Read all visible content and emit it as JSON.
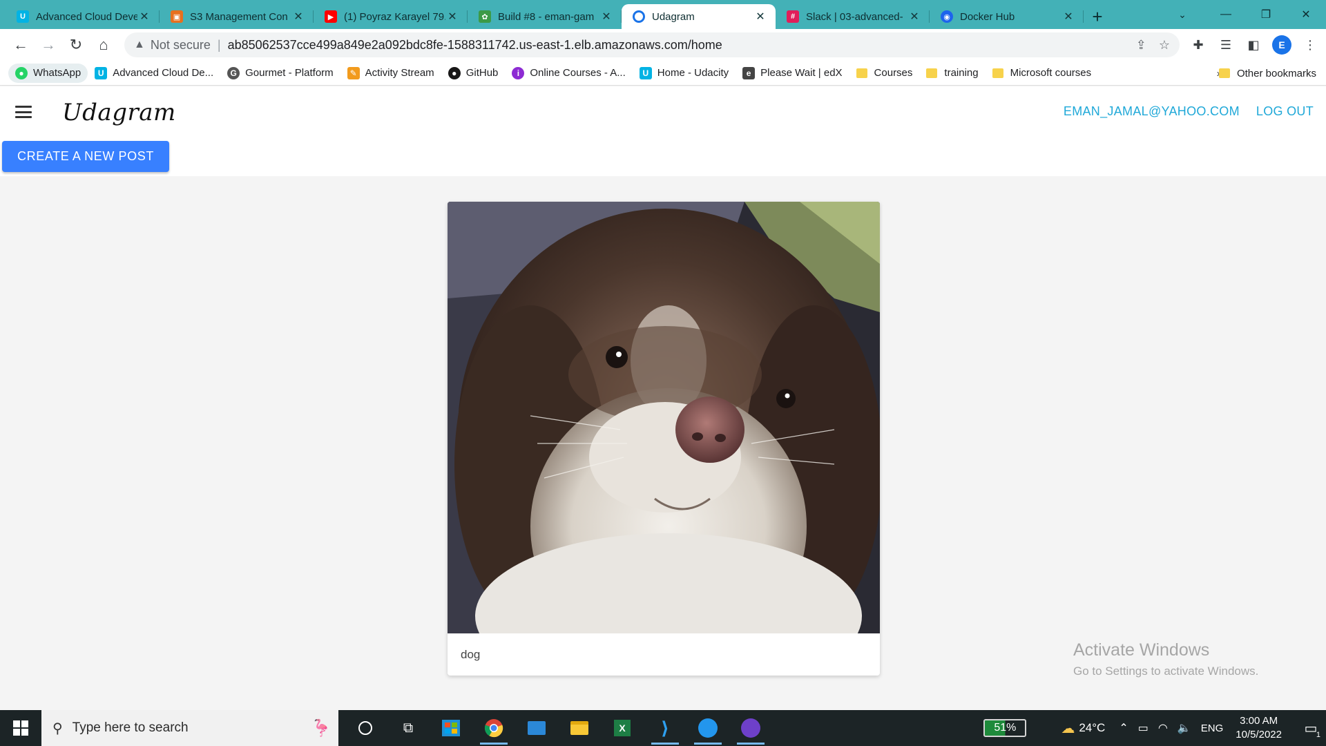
{
  "browser": {
    "tabs": [
      {
        "title": "Advanced Cloud Deve",
        "favicon": "udacity-icon",
        "color": "#02b3e4"
      },
      {
        "title": "S3 Management Con",
        "favicon": "aws-s3-icon",
        "color": "#e7701f"
      },
      {
        "title": "(1) Poyraz Karayel 79.",
        "favicon": "youtube-icon",
        "color": "#ff0000"
      },
      {
        "title": "Build #8 - eman-gam",
        "favicon": "circleci-icon",
        "color": "#3c9a47"
      },
      {
        "title": "Udagram",
        "favicon": "globe-icon",
        "color": "#1a73e8"
      },
      {
        "title": "Slack | 03-advanced-",
        "favicon": "slack-icon",
        "color": "#e01e5a"
      },
      {
        "title": "Docker Hub",
        "favicon": "docker-icon",
        "color": "#1d63ed"
      }
    ],
    "active_tab_index": 4,
    "address": {
      "security_label": "Not secure",
      "url": "ab85062537cce499a849e2a092bdc8fe-1588311742.us-east-1.elb.amazonaws.com/home"
    },
    "profile_initial": "E",
    "bookmarks": [
      {
        "label": "WhatsApp",
        "icon": "whatsapp-icon",
        "color": "#25d366"
      },
      {
        "label": "Advanced Cloud De...",
        "icon": "udacity-icon",
        "color": "#02b3e4"
      },
      {
        "label": "Gourmet - Platform",
        "icon": "gourmet-icon",
        "color": "#555555"
      },
      {
        "label": "Activity Stream",
        "icon": "activity-icon",
        "color": "#f29b1d"
      },
      {
        "label": "GitHub",
        "icon": "github-icon",
        "color": "#181717"
      },
      {
        "label": "Online Courses - A...",
        "icon": "online-courses-icon",
        "color": "#8d2bd3"
      },
      {
        "label": "Home - Udacity",
        "icon": "udacity-icon",
        "color": "#02b3e4"
      },
      {
        "label": "Please Wait | edX",
        "icon": "edx-icon",
        "color": "#444444"
      },
      {
        "label": "Courses",
        "icon": "folder-icon",
        "color": "#f7d24b"
      },
      {
        "label": "training",
        "icon": "folder-icon",
        "color": "#f7d24b"
      },
      {
        "label": "Microsoft courses",
        "icon": "folder-icon",
        "color": "#f7d24b"
      }
    ],
    "bookmarks_more": "»",
    "other_bookmarks": "Other bookmarks"
  },
  "app": {
    "brand": "Udagram",
    "user_email": "EMAN_JAMAL@YAHOO.COM",
    "logout_label": "LOG OUT",
    "create_post_label": "CREATE A NEW POST",
    "accent_color": "#3880ff",
    "link_color": "#1fa8d8",
    "posts": [
      {
        "caption": "dog",
        "image": "dog-photo"
      }
    ]
  },
  "watermark": {
    "title": "Activate Windows",
    "subtitle": "Go to Settings to activate Windows."
  },
  "taskbar": {
    "search_placeholder": "Type here to search",
    "battery_percent": "51%",
    "weather": "24°C",
    "language": "ENG",
    "time": "3:00 AM",
    "date": "10/5/2022",
    "notification_count": "1"
  }
}
